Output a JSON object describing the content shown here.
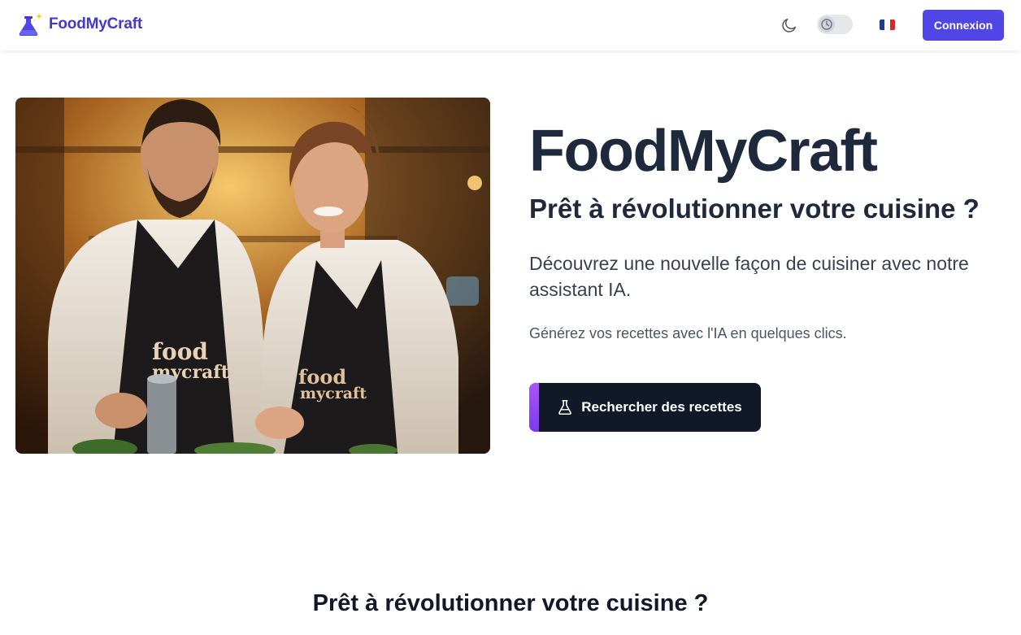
{
  "header": {
    "brand": "FoodMyCraft",
    "login_label": "Connexion",
    "icons": [
      "flask-sparkle-logo-icon",
      "moon-icon",
      "clock-icon",
      "france-flag-icon"
    ]
  },
  "hero": {
    "title": "FoodMyCraft",
    "subtitle": "Prêt à révolutionner votre cuisine ?",
    "description": "Découvrez une nouvelle façon de cuisiner avec notre assistant IA.",
    "tagline": "Générez vos recettes avec l'IA en quelques clics.",
    "cta_label": "Rechercher des recettes",
    "apron_text_1": "food",
    "apron_text_2": "mycraft"
  },
  "section": {
    "title": "Prêt à révolutionner votre cuisine ?"
  },
  "colors": {
    "brand": "#4338ca",
    "button": "#4f46e5",
    "cta_bg": "#111827",
    "cta_accent": "#a855f7"
  }
}
